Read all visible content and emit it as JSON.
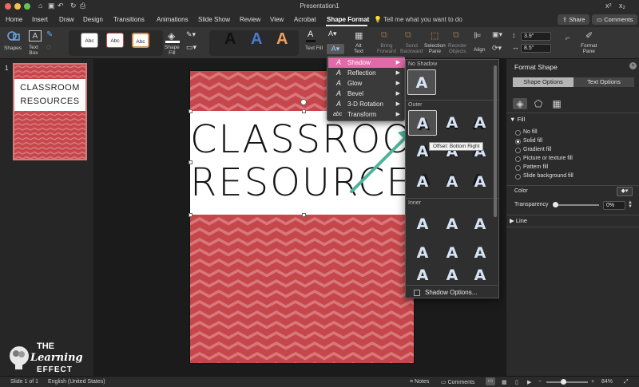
{
  "window": {
    "title": "Presentation1"
  },
  "tabs": [
    "Home",
    "Insert",
    "Draw",
    "Design",
    "Transitions",
    "Animations",
    "Slide Show",
    "Review",
    "View",
    "Acrobat",
    "Shape Format"
  ],
  "tell_me": "Tell me what you want to do",
  "share_label": "Share",
  "comments_label": "Comments",
  "ribbon": {
    "shapes": "Shapes",
    "text_box": "Text\nBox",
    "style_abc": "Abc",
    "shape_fill": "Shape\nFill",
    "wordart_a": "A",
    "text_fill": "Text Fill",
    "alt_text": "Alt\nText",
    "bring_forward": "Bring\nForward",
    "send_backward": "Send\nBackward",
    "selection_pane": "Selection\nPane",
    "reorder_objects": "Reorder\nObjects",
    "align": "Align",
    "height": "3.9\"",
    "width": "8.5\"",
    "format_pane": "Format\nPane"
  },
  "thumbnail": {
    "number": "1",
    "title_l1": "CLASSROOM",
    "title_l2": "RESOURCES"
  },
  "logo": {
    "line1": "THE",
    "line2": "Learning",
    "line3": "EFFECT"
  },
  "slide": {
    "title_l1": "CLASSROOM",
    "title_l2": "RESOURCES"
  },
  "text_effects_menu": [
    {
      "label": "Shadow",
      "icon": "A"
    },
    {
      "label": "Reflection",
      "icon": "A"
    },
    {
      "label": "Glow",
      "icon": "A"
    },
    {
      "label": "Bevel",
      "icon": "A"
    },
    {
      "label": "3-D Rotation",
      "icon": "A"
    },
    {
      "label": "Transform",
      "icon": "abc"
    }
  ],
  "shadow_gallery": {
    "no_shadow": "No Shadow",
    "outer": "Outer",
    "inner": "Inner",
    "glyph": "A",
    "tooltip": "Offset: Bottom Right",
    "options": "Shadow Options..."
  },
  "format_pane": {
    "title": "Format Shape",
    "tab_shape": "Shape Options",
    "tab_text": "Text Options",
    "fill_header": "Fill",
    "fill_options": [
      "No fill",
      "Solid fill",
      "Gradient fill",
      "Picture or texture fill",
      "Pattern fill",
      "Slide background fill"
    ],
    "selected_fill": 1,
    "color_label": "Color",
    "transparency_label": "Transparency",
    "transparency_value": "0%",
    "line_header": "Line"
  },
  "status": {
    "slide_of": "Slide 1 of 1",
    "language": "English (United States)",
    "notes": "Notes",
    "comments": "Comments",
    "zoom": "84%"
  },
  "colors": {
    "slide_red": "#c6474b",
    "chevron_light": "#d9787a",
    "menu_highlight": "#e36aa8",
    "arrow_teal": "#4fb39a"
  }
}
